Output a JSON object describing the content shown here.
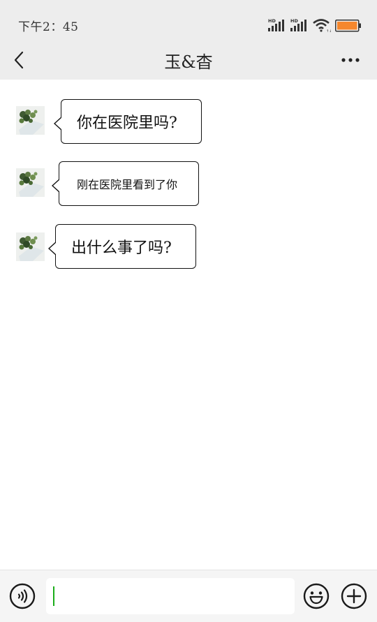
{
  "status_bar": {
    "time": "下午2：45",
    "battery_color": "#f5872d"
  },
  "header": {
    "title": "玉&杳"
  },
  "messages": [
    {
      "text": "你在医院里吗?"
    },
    {
      "text": "刚在医院里看到了你"
    },
    {
      "text": "出什么事了吗?"
    }
  ],
  "input_bar": {
    "value": "",
    "caret_color": "#1aad19"
  },
  "icons": {
    "back": "chevron-left-icon",
    "more": "more-dots-icon",
    "voice": "voice-icon",
    "emoji": "emoji-icon",
    "plus": "plus-icon"
  }
}
